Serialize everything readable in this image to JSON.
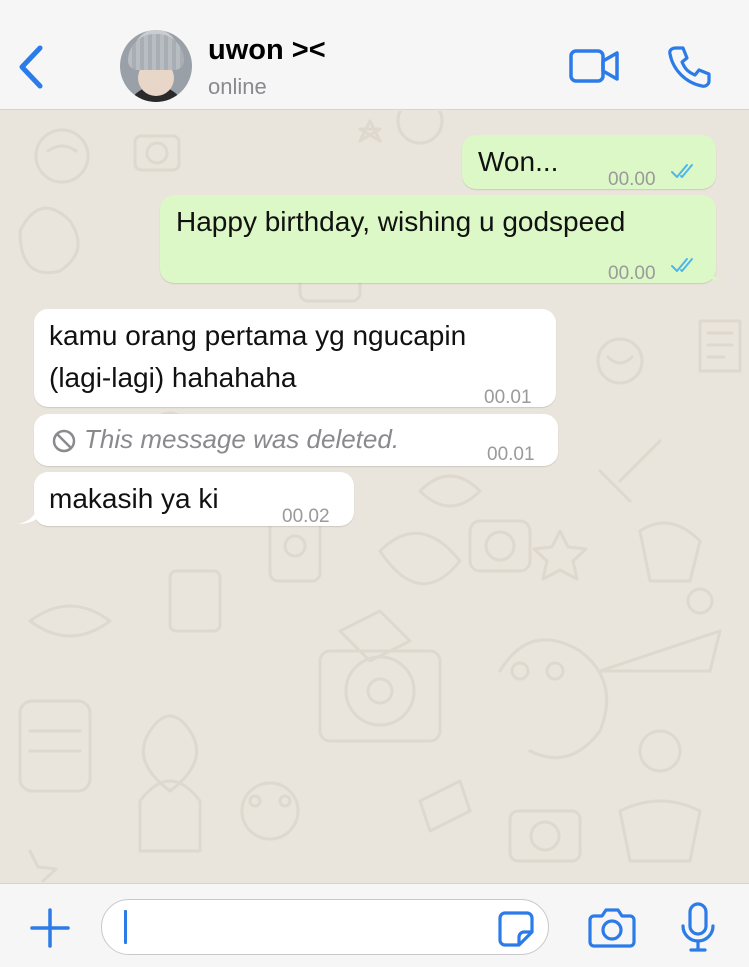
{
  "header": {
    "contact_name": "uwon ><",
    "status": "online"
  },
  "messages": [
    {
      "direction": "outgoing",
      "text": "Won...",
      "time": "00.00",
      "read": true
    },
    {
      "direction": "outgoing",
      "text": "Happy birthday, wishing u godspeed",
      "time": "00.00",
      "read": true
    },
    {
      "direction": "incoming",
      "text_lines": [
        "kamu orang pertama yg ngucapin",
        "(lagi-lagi) hahahaha"
      ],
      "time": "00.01"
    },
    {
      "direction": "incoming",
      "deleted": true,
      "text": "This message was deleted.",
      "time": "00.01"
    },
    {
      "direction": "incoming",
      "text": "makasih ya ki",
      "time": "00.02"
    }
  ],
  "input": {
    "value": "",
    "placeholder": ""
  },
  "colors": {
    "accent": "#2b7be8",
    "outgoing_bubble": "#dcf8c6",
    "incoming_bubble": "#ffffff",
    "chat_background": "#e9e4dc",
    "read_ticks": "#4fb6ec"
  },
  "icons": [
    "chevron-left-icon",
    "video-camera-icon",
    "phone-icon",
    "plus-icon",
    "sticker-icon",
    "camera-icon",
    "microphone-icon",
    "double-check-icon",
    "block-icon"
  ]
}
